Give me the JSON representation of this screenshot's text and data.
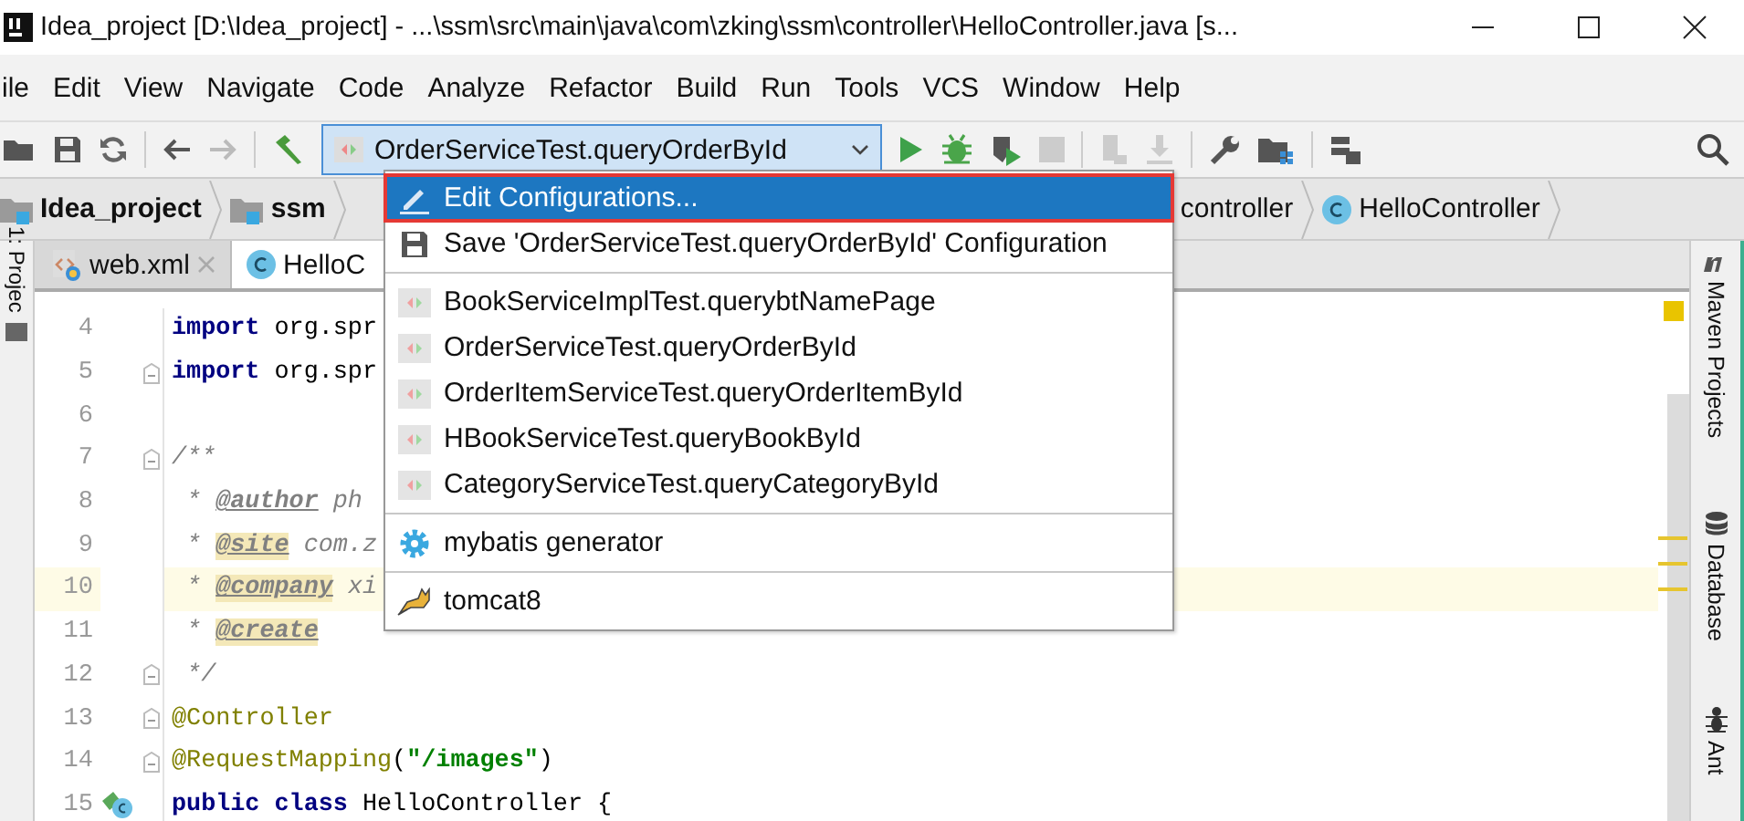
{
  "window": {
    "title": "Idea_project [D:\\Idea_project] - ...\\ssm\\src\\main\\java\\com\\zking\\ssm\\controller\\HelloController.java [s..."
  },
  "menu_bar": [
    "ile",
    "Edit",
    "View",
    "Navigate",
    "Code",
    "Analyze",
    "Refactor",
    "Build",
    "Run",
    "Tools",
    "VCS",
    "Window",
    "Help"
  ],
  "toolbar": {
    "run_config": {
      "label": "OrderServiceTest.queryOrderById",
      "selected": true
    }
  },
  "breadcrumbs": [
    {
      "label": "Idea_project",
      "kind": "folder"
    },
    {
      "label": "ssm",
      "kind": "folder"
    },
    {
      "label": "controller",
      "kind": "package"
    },
    {
      "label": "HelloController",
      "kind": "class"
    }
  ],
  "tabs": [
    {
      "label": "web.xml",
      "kind": "xml",
      "selected": false
    },
    {
      "label": "HelloC",
      "kind": "class",
      "selected": true
    }
  ],
  "left_tool_window": "1: Projec",
  "right_tool_windows": [
    {
      "label": "Maven Projects",
      "kind": "maven"
    },
    {
      "label": "Database",
      "kind": "database"
    },
    {
      "label": "Ant",
      "kind": "ant"
    }
  ],
  "editor": {
    "lines": [
      {
        "number": "4",
        "fold": false,
        "current": false,
        "tokens": [
          {
            "kind": "keyword",
            "text": "import"
          },
          {
            "kind": "plain",
            "text": " org.spr"
          }
        ]
      },
      {
        "number": "5",
        "fold": true,
        "current": false,
        "tokens": [
          {
            "kind": "keyword",
            "text": "import"
          },
          {
            "kind": "plain",
            "text": " org.spr"
          }
        ]
      },
      {
        "number": "6",
        "fold": false,
        "current": false
      },
      {
        "number": "7",
        "fold": true,
        "current": false,
        "tokens": [
          {
            "kind": "comment",
            "text": "/**"
          }
        ]
      },
      {
        "number": "8",
        "fold": false,
        "current": false,
        "tokens": [
          {
            "kind": "comment",
            "text": " * "
          },
          {
            "kind": "doctag",
            "text": "@author"
          },
          {
            "kind": "comment",
            "text": " ph"
          }
        ]
      },
      {
        "number": "9",
        "fold": false,
        "current": false,
        "tokens": [
          {
            "kind": "comment",
            "text": " * "
          },
          {
            "kind": "doctag_marked",
            "text": "@site"
          },
          {
            "kind": "comment",
            "text": " com.z"
          }
        ]
      },
      {
        "number": "10",
        "fold": false,
        "current": true,
        "tokens": [
          {
            "kind": "comment",
            "text": " * "
          },
          {
            "kind": "doctag_marked",
            "text": "@company"
          },
          {
            "kind": "comment",
            "text": " xi"
          }
        ]
      },
      {
        "number": "11",
        "fold": false,
        "current": false,
        "tokens": [
          {
            "kind": "comment",
            "text": " * "
          },
          {
            "kind": "doctag_marked",
            "text": "@create"
          }
        ]
      },
      {
        "number": "12",
        "fold": true,
        "current": false,
        "tokens": [
          {
            "kind": "comment",
            "text": " */"
          }
        ]
      },
      {
        "number": "13",
        "fold": true,
        "current": false,
        "tokens": [
          {
            "kind": "annotation",
            "text": "@Controller"
          }
        ]
      },
      {
        "number": "14",
        "fold": true,
        "current": false,
        "tokens": [
          {
            "kind": "annotation",
            "text": "@RequestMapping"
          },
          {
            "kind": "plain",
            "text": "("
          },
          {
            "kind": "string",
            "text": "\"/images\""
          },
          {
            "kind": "plain",
            "text": ")"
          }
        ]
      },
      {
        "number": "15",
        "fold": false,
        "current": false,
        "class_marker": true,
        "tokens": [
          {
            "kind": "keyword",
            "text": "public class"
          },
          {
            "kind": "plain",
            "text": " HelloController {"
          }
        ]
      }
    ]
  },
  "popup": {
    "groups": [
      [
        {
          "kind": "edit",
          "label": "Edit Configurations...",
          "selected": true,
          "outlined": true
        },
        {
          "kind": "save",
          "label": "Save 'OrderServiceTest.queryOrderById' Configuration",
          "selected": false,
          "outlined": false
        }
      ],
      [
        {
          "kind": "junit",
          "label": "BookServiceImplTest.querybtNamePage",
          "selected": false,
          "outlined": false
        },
        {
          "kind": "junit",
          "label": "OrderServiceTest.queryOrderById",
          "selected": false,
          "outlined": false
        },
        {
          "kind": "junit",
          "label": "OrderItemServiceTest.queryOrderItemById",
          "selected": false,
          "outlined": false
        },
        {
          "kind": "junit",
          "label": "HBookServiceTest.queryBookById",
          "selected": false,
          "outlined": false
        },
        {
          "kind": "junit",
          "label": "CategoryServiceTest.queryCategoryById",
          "selected": false,
          "outlined": false
        }
      ],
      [
        {
          "kind": "gear",
          "label": "mybatis generator",
          "selected": false,
          "outlined": false
        }
      ],
      [
        {
          "kind": "tomcat",
          "label": "tomcat8",
          "selected": false,
          "outlined": false
        }
      ]
    ]
  }
}
